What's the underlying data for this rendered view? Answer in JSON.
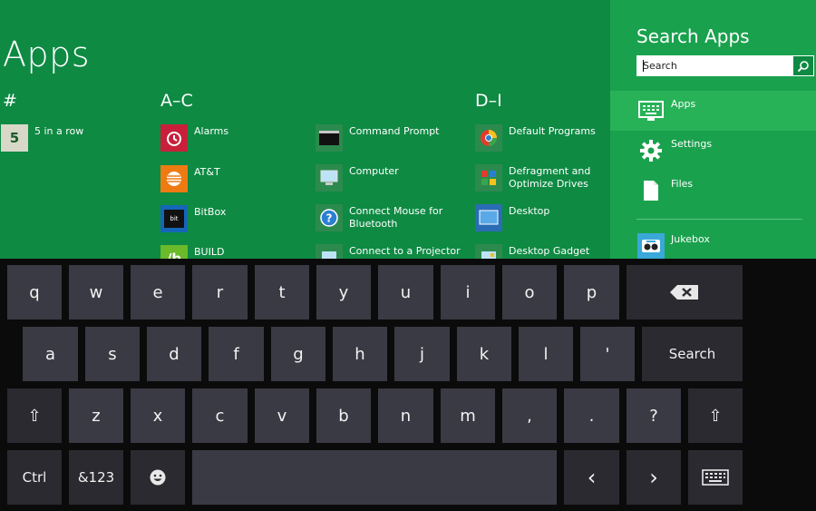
{
  "apps": {
    "title": "Apps",
    "groups": [
      {
        "header": "#"
      },
      {
        "header": "A–C"
      },
      {
        "header": "D–I"
      }
    ],
    "items": [
      {
        "label": "5 in a row",
        "icon": "five-in-a-row-icon",
        "color": "#d8d8c8"
      },
      {
        "label": "Alarms",
        "icon": "alarm-clock-icon",
        "color": "#c8203a"
      },
      {
        "label": "AT&T",
        "icon": "att-globe-icon",
        "color": "#ee7a12"
      },
      {
        "label": "BitBox",
        "icon": "bitbox-icon",
        "color": "#1566b8"
      },
      {
        "label": "BUILD",
        "icon": "build-icon",
        "color": "#6aba2a"
      },
      {
        "label": "Command Prompt",
        "icon": "command-prompt-icon",
        "color": "#111111"
      },
      {
        "label": "Computer",
        "icon": "computer-icon",
        "color": "#2c8a4f"
      },
      {
        "label": "Connect Mouse for Bluetooth",
        "icon": "help-icon",
        "color": "#2c8a4f"
      },
      {
        "label": "Connect to a Projector",
        "icon": "projector-icon",
        "color": "#2c8a4f"
      },
      {
        "label": "Default Programs",
        "icon": "default-programs-icon",
        "color": "#2c8a4f"
      },
      {
        "label": "Defragment and Optimize Drives",
        "icon": "defragment-icon",
        "color": "#2c8a4f"
      },
      {
        "label": "Desktop",
        "icon": "desktop-icon",
        "color": "#2a6db5"
      },
      {
        "label": "Desktop Gadget",
        "icon": "desktop-gadget-icon",
        "color": "#2c8a4f"
      }
    ]
  },
  "search": {
    "title": "Search Apps",
    "placeholder": "Search",
    "scopes": [
      {
        "label": "Apps",
        "icon": "keyboard-apps-icon"
      },
      {
        "label": "Settings",
        "icon": "settings-gear-icon"
      },
      {
        "label": "Files",
        "icon": "file-icon"
      }
    ],
    "suggestion": {
      "label": "Jukebox",
      "icon": "jukebox-icon",
      "color": "#3aa8d8"
    }
  },
  "keyboard": {
    "row1": [
      "q",
      "w",
      "e",
      "r",
      "t",
      "y",
      "u",
      "i",
      "o",
      "p"
    ],
    "row2": [
      "a",
      "s",
      "d",
      "f",
      "g",
      "h",
      "j",
      "k",
      "l",
      "'"
    ],
    "row3": [
      "z",
      "x",
      "c",
      "v",
      "b",
      "n",
      "m",
      ",",
      ".",
      "?"
    ],
    "search_label": "Search",
    "ctrl_label": "Ctrl",
    "symbols_label": "&123",
    "left_arrow": "‹",
    "right_arrow": "›",
    "shift_glyph": "⇧"
  }
}
